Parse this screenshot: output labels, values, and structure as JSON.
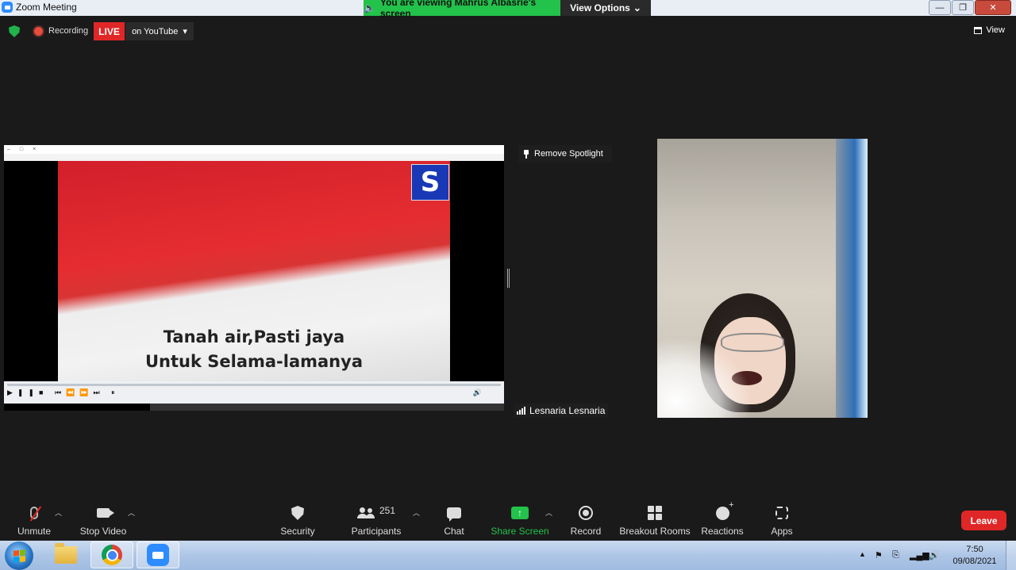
{
  "window": {
    "title": "Zoom Meeting",
    "viewing_banner": "You are viewing Mahrus Albasrie's screen",
    "view_options": "View Options"
  },
  "status": {
    "recording": "Recording",
    "live": "LIVE",
    "youtube": "on YouTube",
    "view": "View"
  },
  "shared_screen": {
    "lyric_line1": "Tanah air,Pasti jaya",
    "lyric_line2": "Untuk Selama-lamanya",
    "logo_letter": "S"
  },
  "spotlight": {
    "remove_label": "Remove Spotlight"
  },
  "participant": {
    "name": "Lesnaria Lesnaria"
  },
  "toolbar": {
    "unmute": "Unmute",
    "stop_video": "Stop Video",
    "security": "Security",
    "participants": "Participants",
    "participant_count": "251",
    "chat": "Chat",
    "share_screen": "Share Screen",
    "record": "Record",
    "breakout_rooms": "Breakout Rooms",
    "reactions": "Reactions",
    "apps": "Apps",
    "leave": "Leave"
  },
  "taskbar": {
    "time": "7:50",
    "date": "09/08/2021"
  },
  "colors": {
    "accent_green": "#23c24b",
    "live_red": "#e02727",
    "zoom_blue": "#2d8cff"
  },
  "icons": [
    "shield-icon",
    "record-dot-icon",
    "grid-icon",
    "pin-icon",
    "signal-bars-icon",
    "microphone-muted-icon",
    "video-camera-icon",
    "security-shield-icon",
    "participants-icon",
    "chat-bubble-icon",
    "share-screen-arrow-icon",
    "record-icon",
    "breakout-rooms-icon",
    "reactions-icon",
    "apps-icon"
  ]
}
